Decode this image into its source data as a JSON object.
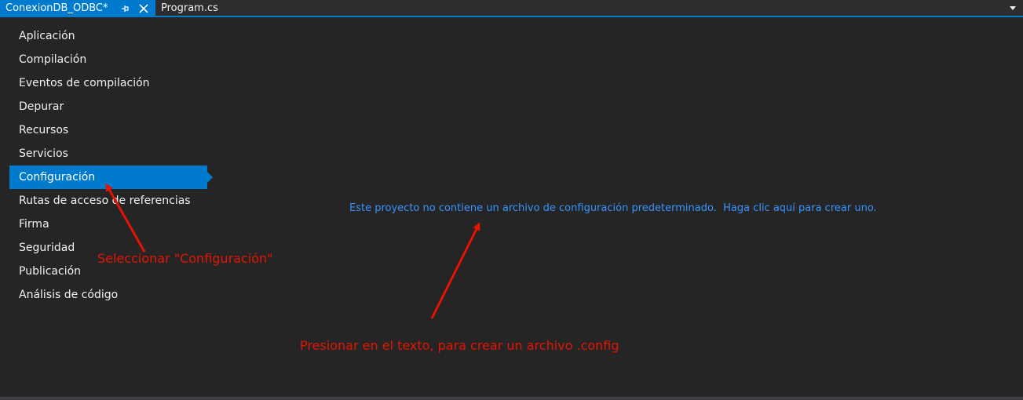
{
  "tabs": {
    "active": {
      "title": "ConexionDB_ODBC*",
      "pin_icon": "pin-icon",
      "close_icon": "close-icon"
    },
    "inactive": {
      "title": "Program.cs"
    },
    "dropdown_icon": "chevron-down-icon"
  },
  "nav": {
    "items": [
      {
        "label": "Aplicación"
      },
      {
        "label": "Compilación"
      },
      {
        "label": "Eventos de compilación"
      },
      {
        "label": "Depurar"
      },
      {
        "label": "Recursos"
      },
      {
        "label": "Servicios"
      },
      {
        "label": "Configuración",
        "selected": true
      },
      {
        "label": "Rutas de acceso de referencias"
      },
      {
        "label": "Firma"
      },
      {
        "label": "Seguridad"
      },
      {
        "label": "Publicación"
      },
      {
        "label": "Análisis de código"
      }
    ]
  },
  "main": {
    "link_text": "Este proyecto no contiene un archivo de configuración predeterminado.  Haga clic aquí para crear uno."
  },
  "annotations": {
    "select_config": "Seleccionar \"Configuración\"",
    "press_text": "Presionar en el texto, para crear un archivo .config"
  },
  "colors": {
    "accent": "#007acc",
    "background": "#252526",
    "link": "#3794ff",
    "annotation": "#e51400"
  }
}
